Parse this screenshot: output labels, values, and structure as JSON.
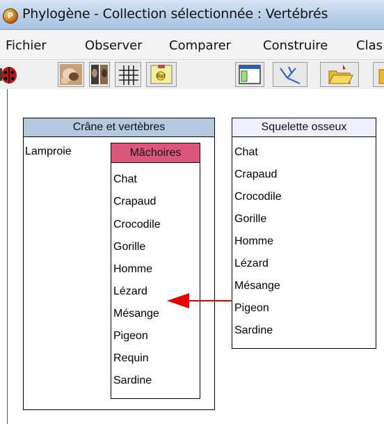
{
  "window": {
    "title": "Phylogène - Collection sélectionnée : Vertébrés",
    "app_icon": "app-logo-icon"
  },
  "menu": {
    "items": [
      "Fichier",
      "Observer",
      "Comparer",
      "Construire",
      "Clas"
    ]
  },
  "toolbar": {
    "buttons": [
      {
        "name": "ladybug-icon"
      },
      {
        "name": "skull-photo-icon"
      },
      {
        "name": "compare-photos-icon"
      },
      {
        "name": "grid-matrix-icon"
      },
      {
        "name": "reference-notebook-icon"
      },
      {
        "name": "window-panel-icon"
      },
      {
        "name": "tree-branch-icon"
      },
      {
        "name": "open-folder-icon"
      },
      {
        "name": "next-folder-icon"
      }
    ]
  },
  "groups": {
    "outer": {
      "title": "Crâne et vertèbres",
      "loose_member": "Lamproie",
      "inner": {
        "title": "Mâchoires",
        "items": [
          "Chat",
          "Crapaud",
          "Crocodile",
          "Gorille",
          "Homme",
          "Lézard",
          "Mésange",
          "Pigeon",
          "Requin",
          "Sardine"
        ]
      }
    },
    "right": {
      "title": "Squelette osseux",
      "items": [
        "Chat",
        "Crapaud",
        "Crocodile",
        "Gorille",
        "Homme",
        "Lézard",
        "Mésange",
        "Pigeon",
        "Sardine"
      ]
    }
  },
  "colors": {
    "header_blue": "#b4c8e0",
    "header_pink": "#d9587a",
    "arrow_red": "#e60000"
  }
}
